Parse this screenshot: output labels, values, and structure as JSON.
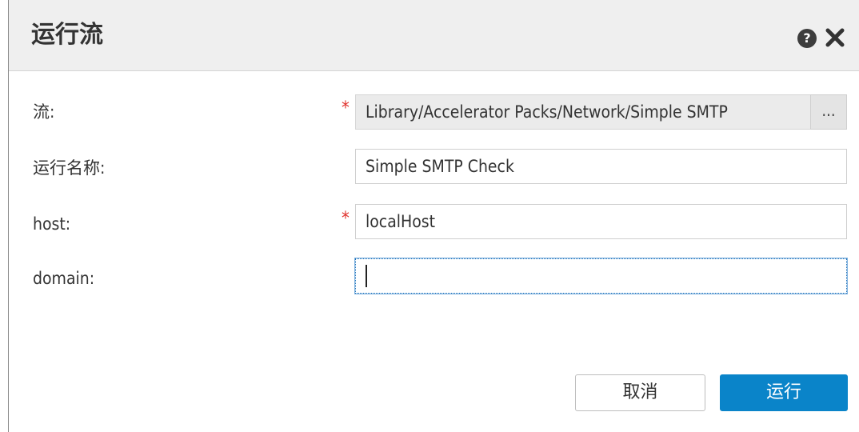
{
  "dialog": {
    "title": "运行流",
    "help_icon": "question-circle-icon",
    "help_glyph": "?",
    "close_icon": "close-icon"
  },
  "form": {
    "flow": {
      "label": "流:",
      "required": true,
      "value": "Library/Accelerator Packs/Network/Simple SMTP",
      "browse_label": "..."
    },
    "run_name": {
      "label": "运行名称:",
      "required": false,
      "value": "Simple SMTP Check"
    },
    "host": {
      "label": "host:",
      "required": true,
      "value": "localHost"
    },
    "domain": {
      "label": "domain:",
      "required": false,
      "value": ""
    },
    "required_marker": "*"
  },
  "footer": {
    "cancel_label": "取消",
    "run_label": "运行"
  },
  "colors": {
    "header_bg": "#efefef",
    "primary_button": "#0a84c9",
    "required_star": "#e0312c",
    "readonly_field": "#ebebeb"
  }
}
